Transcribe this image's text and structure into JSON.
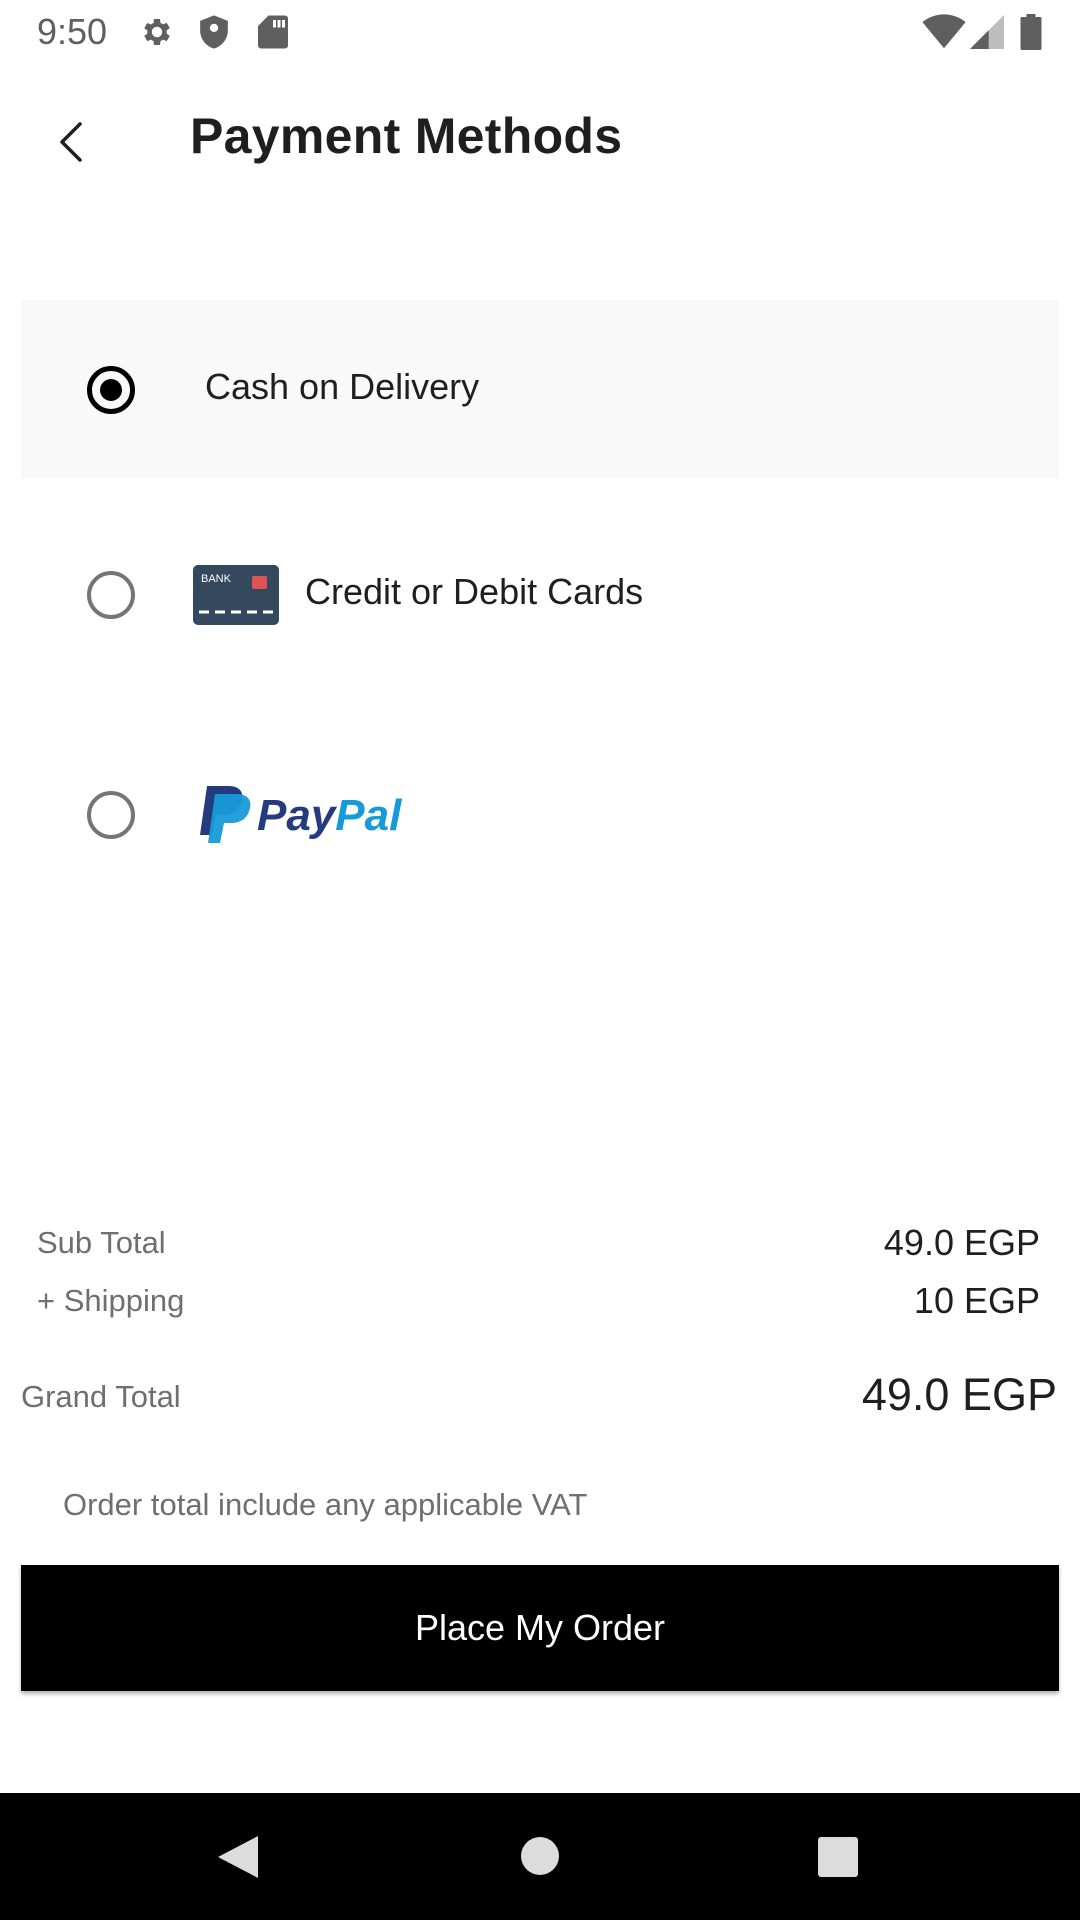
{
  "status_bar": {
    "time": "9:50",
    "icons": [
      "gear-icon",
      "shield-icon",
      "sd-card-icon",
      "wifi-icon",
      "cell-signal-icon",
      "battery-icon"
    ]
  },
  "app_bar": {
    "back_icon": "back-arrow-icon",
    "title": "Payment Methods"
  },
  "payment_options": [
    {
      "label": "Cash on Delivery",
      "selected": true
    },
    {
      "label": "Credit or Debit Cards",
      "selected": false,
      "icon": "bank-card-icon",
      "icon_text": "BANK"
    },
    {
      "label": "PayPal",
      "selected": false,
      "icon": "paypal-logo"
    }
  ],
  "summary": {
    "sub_total_label": "Sub Total",
    "sub_total_value": "49.0 EGP",
    "shipping_label": "+ Shipping",
    "shipping_value": "10 EGP",
    "grand_total_label": "Grand Total",
    "grand_total_value": "49.0 EGP",
    "vat_note": "Order total include any applicable VAT"
  },
  "place_order_button": "Place My Order",
  "nav_bar": {
    "icons": [
      "nav-back-icon",
      "nav-home-icon",
      "nav-recents-icon"
    ]
  },
  "colors": {
    "selected_row_bg": "#f9f9f9",
    "button_bg": "#000000",
    "paypal_dark": "#253b80",
    "paypal_light": "#179bd7"
  }
}
